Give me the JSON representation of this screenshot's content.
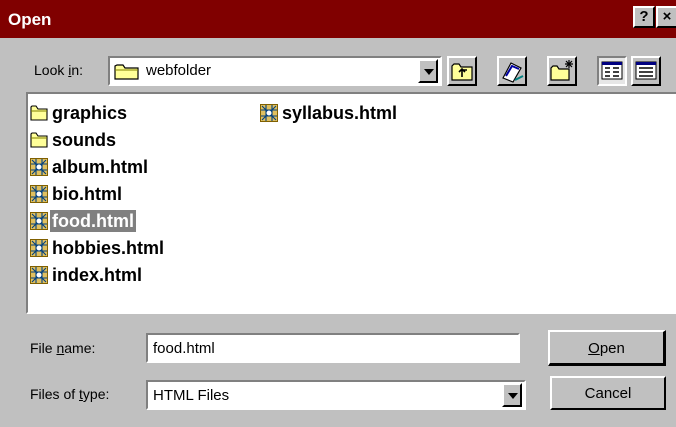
{
  "title": "Open",
  "title_buttons": {
    "help": "?",
    "close": "×"
  },
  "look_in": {
    "label_pre": "Look ",
    "label_key": "i",
    "label_post": "n:",
    "value": "webfolder"
  },
  "toolbar": [
    "up-one-level",
    "desktop",
    "create-new-folder",
    "list-view",
    "details-view"
  ],
  "files": {
    "col1": [
      {
        "name": "graphics",
        "type": "folder",
        "selected": false
      },
      {
        "name": "sounds",
        "type": "folder",
        "selected": false
      },
      {
        "name": "album.html",
        "type": "html",
        "selected": false
      },
      {
        "name": "bio.html",
        "type": "html",
        "selected": false
      },
      {
        "name": "food.html",
        "type": "html",
        "selected": true
      },
      {
        "name": "hobbies.html",
        "type": "html",
        "selected": false
      },
      {
        "name": "index.html",
        "type": "html",
        "selected": false
      }
    ],
    "col2": [
      {
        "name": "syllabus.html",
        "type": "html",
        "selected": false
      }
    ]
  },
  "file_name": {
    "label_pre": "File ",
    "label_key": "n",
    "label_post": "ame:",
    "value": "food.html"
  },
  "file_type": {
    "label_pre": "Files of ",
    "label_key": "t",
    "label_post": "ype:",
    "value": "HTML Files"
  },
  "buttons": {
    "open_key": "O",
    "open_rest": "pen",
    "cancel": "Cancel"
  },
  "colors": {
    "title_bg": "#800000",
    "face": "#c0c0c0",
    "selection": "#808080",
    "folder": "#ffff99"
  }
}
